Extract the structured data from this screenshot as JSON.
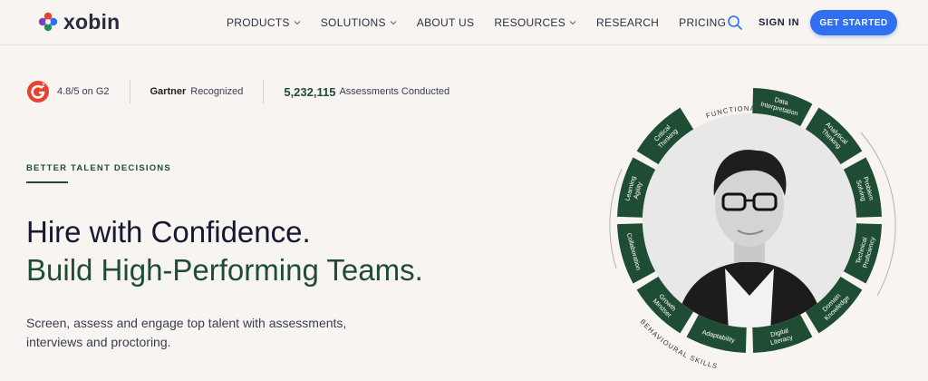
{
  "nav": {
    "logo_text": "xobin",
    "items": [
      {
        "label": "PRODUCTS",
        "dropdown": true
      },
      {
        "label": "SOLUTIONS",
        "dropdown": true
      },
      {
        "label": "ABOUT US",
        "dropdown": false
      },
      {
        "label": "RESOURCES",
        "dropdown": true
      },
      {
        "label": "RESEARCH",
        "dropdown": false
      },
      {
        "label": "PRICING",
        "dropdown": false
      }
    ],
    "signin_label": "SIGN IN",
    "cta_label": "GET STARTED"
  },
  "stats": {
    "g2_rating": "4.8/5 on G2",
    "gartner_brand": "Gartner",
    "gartner_text": "Recognized",
    "assessments_count": "5,232,115",
    "assessments_text": "Assessments Conducted"
  },
  "hero": {
    "eyebrow": "BETTER TALENT DECISIONS",
    "headline_1": "Hire with Confidence.",
    "headline_2": "Build High-Performing Teams.",
    "subtext": "Screen, assess and engage top talent with assessments, interviews and proctoring."
  },
  "wheel": {
    "top_label": "FUNCTIONAL SKILLS",
    "bottom_label": "BEHAVIOURAL SKILLS",
    "skills": [
      [
        "Data",
        "Interpretation"
      ],
      [
        "Analytical",
        "Thinking"
      ],
      [
        "Problem",
        "Solving"
      ],
      [
        "Technical",
        "Proficiency"
      ],
      [
        "Domain",
        "Knowledge"
      ],
      [
        "Digital",
        "Literacy"
      ],
      [
        "Adaptability"
      ],
      [
        "Growth",
        "Mindset"
      ],
      [
        "Collaboration"
      ],
      [
        "Learning",
        "Agility"
      ],
      [
        "Critical",
        "Thinking"
      ]
    ]
  },
  "colors": {
    "brand_green": "#1f4d33",
    "cta_blue": "#2f6ff0",
    "background": "#f8f4f1",
    "g2_red": "#e9412b"
  }
}
